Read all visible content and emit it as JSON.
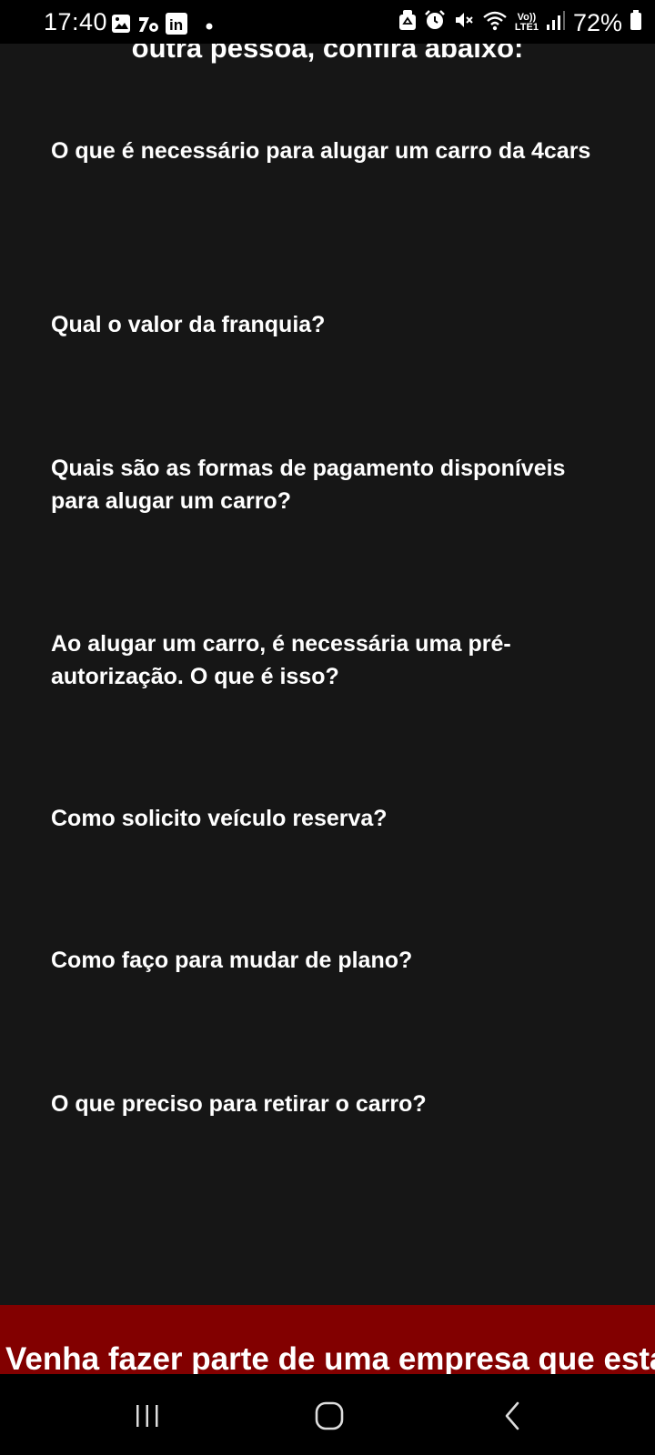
{
  "status_bar": {
    "time": "17:40",
    "left_icons": [
      "gallery-icon",
      "app-notification-icon",
      "linkedin-icon",
      "notification-dot-icon"
    ],
    "right_icons": [
      "recycle-icon",
      "alarm-icon",
      "mute-icon",
      "wifi-icon",
      "volte-lte-icon",
      "signal-icon",
      "battery-icon"
    ],
    "lte_label_top": "Vo))",
    "lte_label_bottom": "LTE1",
    "linkedin_label": "in",
    "battery_percent": "72%"
  },
  "content": {
    "intro_text": "outra pessoa, confira abaixo:",
    "faq_items": [
      "O que é necessário para alugar um carro da 4cars",
      "Qual o valor da franquia?",
      "Quais são as formas de pagamento disponíveis para alugar um carro?",
      "Ao alugar um carro, é necessária uma pré-autorização. O que é isso?",
      "Como solicito veículo reserva?",
      "Como faço para mudar de plano?",
      "O que preciso para retirar o carro?"
    ]
  },
  "cta_banner": {
    "text": "Venha fazer parte de uma empresa que está"
  },
  "nav_bar": {
    "buttons": [
      "recent-apps-icon",
      "home-icon",
      "back-icon"
    ]
  },
  "colors": {
    "background": "#161616",
    "status_bar": "#000000",
    "text": "#ffffff",
    "banner": "#820000"
  }
}
